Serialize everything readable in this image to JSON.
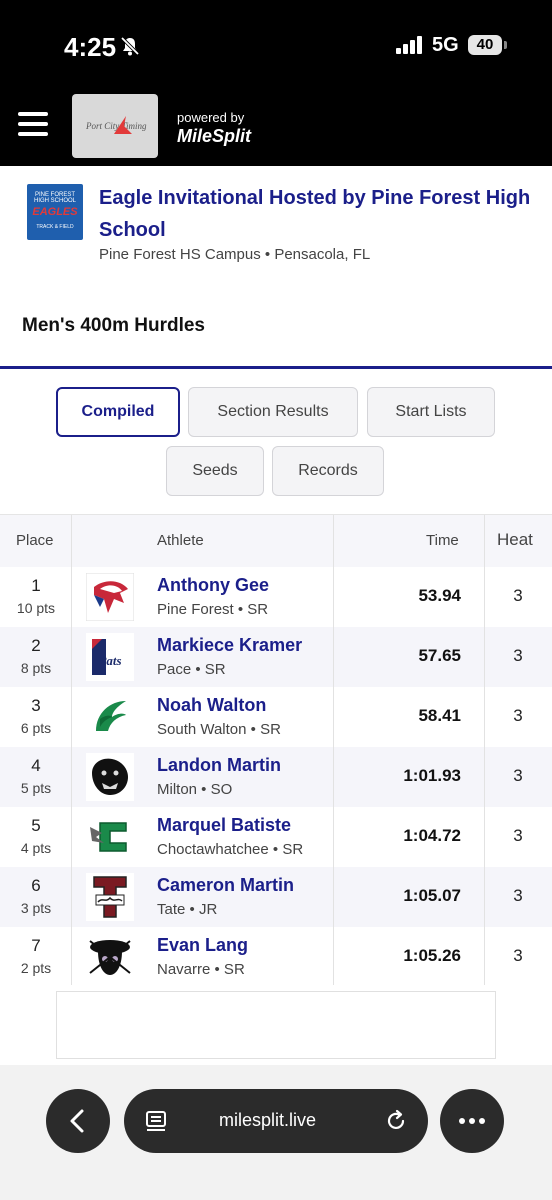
{
  "status_bar": {
    "time": "4:25",
    "network": "5G",
    "battery": "40"
  },
  "header": {
    "logo_text": "Port City Timing",
    "powered_by": "powered by",
    "brand": "MileSplit"
  },
  "meet": {
    "logo_lines": [
      "PINE FOREST HIGH SCHOOL",
      "EAGLES",
      "TRACK & FIELD"
    ],
    "title": "Eagle Invitational Hosted by Pine Forest High School",
    "location": "Pine Forest HS Campus • Pensacola, FL"
  },
  "event": {
    "title": "Men's 400m Hurdles"
  },
  "tabs": [
    {
      "label": "Compiled",
      "active": true
    },
    {
      "label": "Section Results",
      "active": false
    },
    {
      "label": "Start Lists",
      "active": false
    },
    {
      "label": "Seeds",
      "active": false
    },
    {
      "label": "Records",
      "active": false
    }
  ],
  "table": {
    "headers": {
      "place": "Place",
      "athlete": "Athlete",
      "time": "Time",
      "heat": "Heat"
    },
    "rows": [
      {
        "place": "1",
        "pts": "10 pts",
        "athlete": "Anthony Gee",
        "school": "Pine Forest • SR",
        "time": "53.94",
        "heat": "3",
        "logo": "eagle-logo"
      },
      {
        "place": "2",
        "pts": "8 pts",
        "athlete": "Markiece Kramer",
        "school": "Pace • SR",
        "time": "57.65",
        "heat": "3",
        "logo": "patriots-logo"
      },
      {
        "place": "3",
        "pts": "6 pts",
        "athlete": "Noah Walton",
        "school": "South Walton • SR",
        "time": "58.41",
        "heat": "3",
        "logo": "seahawk-logo"
      },
      {
        "place": "4",
        "pts": "5 pts",
        "athlete": "Landon Martin",
        "school": "Milton • SO",
        "time": "1:01.93",
        "heat": "3",
        "logo": "panther-logo"
      },
      {
        "place": "5",
        "pts": "4 pts",
        "athlete": "Marquel Batiste",
        "school": "Choctawhatchee • SR",
        "time": "1:04.72",
        "heat": "3",
        "logo": "c-logo"
      },
      {
        "place": "6",
        "pts": "3 pts",
        "athlete": "Cameron Martin",
        "school": "Tate • JR",
        "time": "1:05.07",
        "heat": "3",
        "logo": "t-eagles-logo"
      },
      {
        "place": "7",
        "pts": "2 pts",
        "athlete": "Evan Lang",
        "school": "Navarre • SR",
        "time": "1:05.26",
        "heat": "3",
        "logo": "raider-logo"
      }
    ]
  },
  "browser": {
    "url": "milesplit.live"
  }
}
